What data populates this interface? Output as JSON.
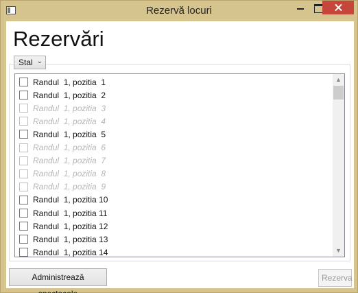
{
  "window": {
    "title": "Rezervă locuri"
  },
  "main": {
    "heading": "Rezervări",
    "section_combo": {
      "selected": "Stal"
    },
    "seats": [
      {
        "label": "Randul  1, pozitia  1",
        "enabled": true
      },
      {
        "label": "Randul  1, pozitia  2",
        "enabled": true
      },
      {
        "label": "Randul  1, pozitia  3",
        "enabled": false
      },
      {
        "label": "Randul  1, pozitia  4",
        "enabled": false
      },
      {
        "label": "Randul  1, pozitia  5",
        "enabled": true
      },
      {
        "label": "Randul  1, pozitia  6",
        "enabled": false
      },
      {
        "label": "Randul  1, pozitia  7",
        "enabled": false
      },
      {
        "label": "Randul  1, pozitia  8",
        "enabled": false
      },
      {
        "label": "Randul  1, pozitia  9",
        "enabled": false
      },
      {
        "label": "Randul  1, pozitia 10",
        "enabled": true
      },
      {
        "label": "Randul  1, pozitia 11",
        "enabled": true
      },
      {
        "label": "Randul  1, pozitia 12",
        "enabled": true
      },
      {
        "label": "Randul  1, pozitia 13",
        "enabled": true
      },
      {
        "label": "Randul  1, pozitia 14",
        "enabled": true
      }
    ]
  },
  "footer": {
    "admin_label": "Administrează spectacole",
    "reserve_label": "Rezerva"
  },
  "icons": {
    "app": "window-icon",
    "minimize": "minimize-icon",
    "maximize": "maximize-icon",
    "close": "close-icon",
    "combo_arrow": "chevron-down-icon",
    "scroll_up": "chevron-up-icon",
    "scroll_down": "chevron-down-icon"
  }
}
